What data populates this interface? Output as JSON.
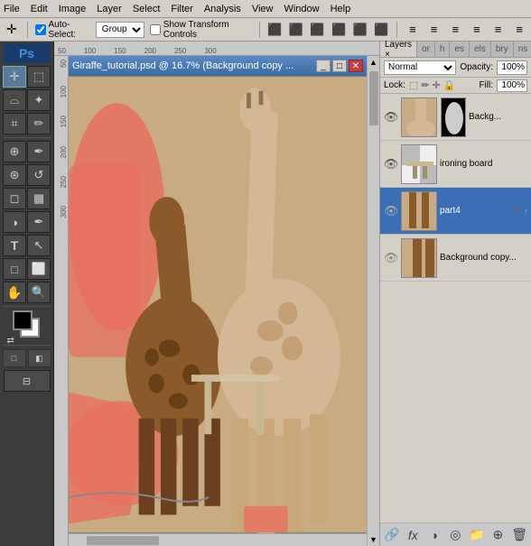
{
  "menubar": {
    "items": [
      "File",
      "Edit",
      "Image",
      "Layer",
      "Select",
      "Filter",
      "Analysis",
      "View",
      "Window",
      "Help"
    ]
  },
  "toolbar": {
    "auto_select_label": "Auto-Select:",
    "group_label": "Group",
    "transform_label": "Show Transform Controls"
  },
  "document": {
    "title": "Giraffe_tutorial.psd @ 16.7% (Background copy ...",
    "subtitle": ""
  },
  "layers_panel": {
    "tabs": [
      "Layers",
      "or",
      "h",
      "es",
      "els",
      "bry",
      "ns"
    ],
    "active_tab": "Layers",
    "mode": "Normal",
    "opacity_label": "Opacity:",
    "opacity_value": "100%",
    "lock_label": "Lock:",
    "fill_label": "Fill:",
    "fill_value": "100%",
    "layers": [
      {
        "name": "Backg...",
        "visible": true,
        "has_mask": true,
        "selected": false,
        "has_fx": false,
        "thumb_color": "#8b7355"
      },
      {
        "name": "ironing board",
        "visible": true,
        "has_mask": false,
        "selected": false,
        "has_fx": false,
        "thumb_color": "#c8b890"
      },
      {
        "name": "part4",
        "visible": false,
        "has_mask": false,
        "selected": true,
        "has_fx": true,
        "thumb_color": "#8b5a3a"
      },
      {
        "name": "Background copy...",
        "visible": false,
        "has_mask": false,
        "selected": false,
        "has_fx": false,
        "thumb_color": "#8b7355"
      }
    ],
    "footer_icons": [
      "link",
      "fx",
      "circle-half",
      "trash",
      "folder",
      "new-layer",
      "delete"
    ]
  }
}
